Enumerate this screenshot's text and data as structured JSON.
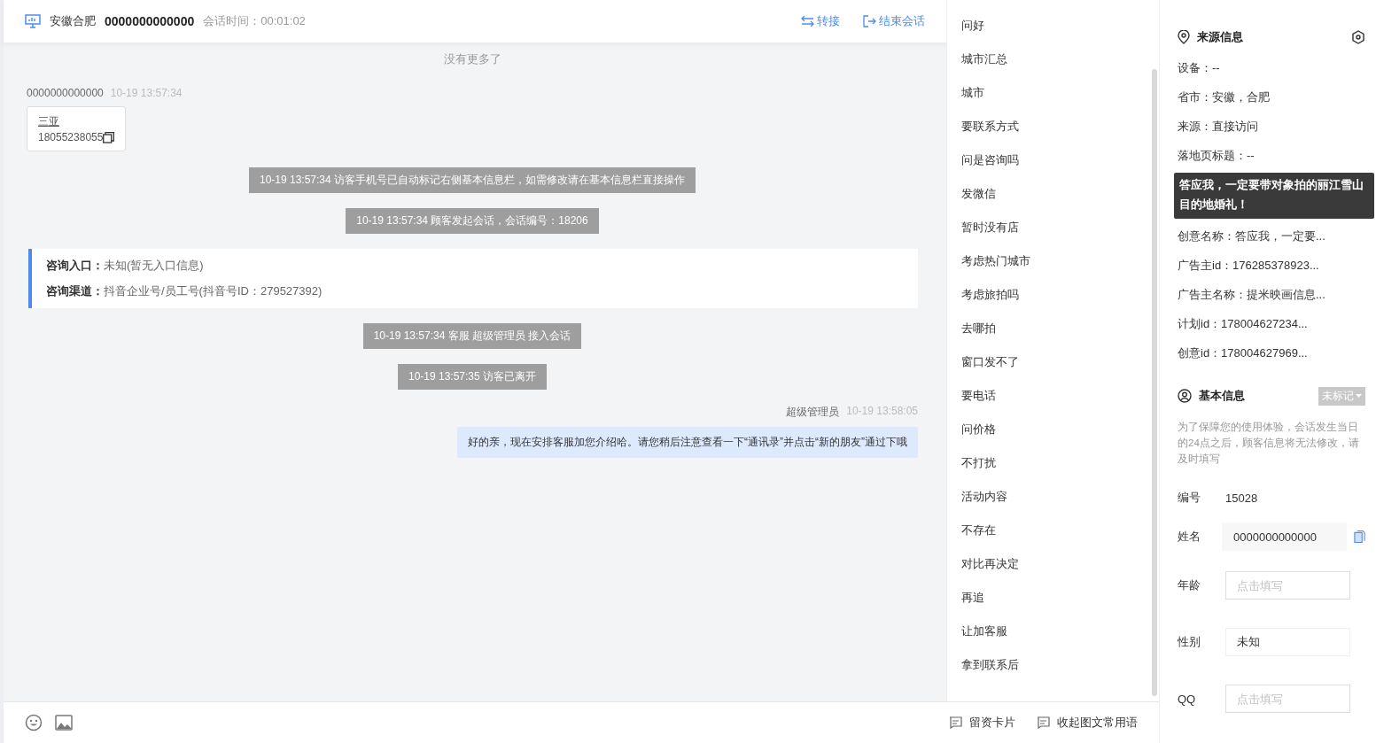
{
  "header": {
    "location": "安徽合肥",
    "visitor": "0000000000000",
    "duration": "会话时间：00:01:02",
    "actions": [
      {
        "kind": "transfer",
        "label": "转接"
      },
      {
        "kind": "end",
        "label": "结束会话"
      }
    ]
  },
  "chat": {
    "no_more": "没有更多了",
    "messages": [
      {
        "kind": "card",
        "sender": "0000000000000",
        "time": "10-19 13:57:34",
        "title": "三亚",
        "phone": "18055238055"
      },
      {
        "kind": "system",
        "text": "10-19 13:57:34 访客手机号已自动标记右侧基本信息栏，如需修改请在基本信息栏直接操作"
      },
      {
        "kind": "system",
        "text": "10-19 13:57:34 顾客发起会话，会话编号：18206"
      },
      {
        "kind": "info",
        "lines": [
          {
            "label": "咨询入口：",
            "value": "未知(暂无入口信息)"
          },
          {
            "label": "咨询渠道：",
            "value": "抖音企业号/员工号(抖音号ID：279527392)"
          }
        ]
      },
      {
        "kind": "system",
        "text": "10-19 13:57:34 客服 超级管理员 接入会话"
      },
      {
        "kind": "system",
        "text": "10-19 13:57:35 访客已离开"
      },
      {
        "kind": "agent",
        "sender": "超级管理员",
        "time": "10-19 13:58:05",
        "text": "好的亲，现在安排客服加您介绍哈。请您稍后注意查看一下“通讯录”并点击“新的朋友”通过下哦"
      }
    ]
  },
  "quick_replies": [
    "问好",
    "城市汇总",
    "城市",
    "要联系方式",
    "问是咨询吗",
    "发微信",
    "暂时没有店",
    "考虑热门城市",
    "考虑旅拍吗",
    "去哪拍",
    "窗口发不了",
    "要电话",
    "问价格",
    "不打扰",
    "活动内容",
    "不存在",
    "对比再决定",
    "再追",
    "让加客服",
    "拿到联系后"
  ],
  "footer": {
    "tools": [
      {
        "kind": "emoji"
      },
      {
        "kind": "image"
      }
    ],
    "actions": [
      "留资卡片",
      "收起图文常用语"
    ]
  },
  "source_info": {
    "title": "来源信息",
    "rows": [
      "设备：--",
      "省市：安徽，合肥",
      "来源：直接访问",
      "落地页标题：--",
      "创意名称：答应我，一定要...",
      "广告主id：176285378923...",
      "广告主名称：提米映画信息...",
      "计划id：178004627234...",
      "创意id：178004627969..."
    ],
    "tooltip": [
      "答应我，一定要带对象拍的丽江雪山",
      "目的地婚礼！"
    ]
  },
  "basic_info": {
    "title": "基本信息",
    "tag": "未标记",
    "notice": "为了保障您的使用体验，会话发生当日的24点之后，顾客信息将无法修改，请及时填写",
    "fields": [
      {
        "kind": "text",
        "label": "编号",
        "value": "15028"
      },
      {
        "kind": "filled",
        "label": "姓名",
        "value": "0000000000000"
      },
      {
        "kind": "input",
        "label": "年龄",
        "placeholder": "点击填写"
      },
      {
        "kind": "select",
        "label": "性别",
        "value": "未知"
      },
      {
        "kind": "input",
        "label": "QQ",
        "placeholder": "点击填写"
      }
    ]
  }
}
